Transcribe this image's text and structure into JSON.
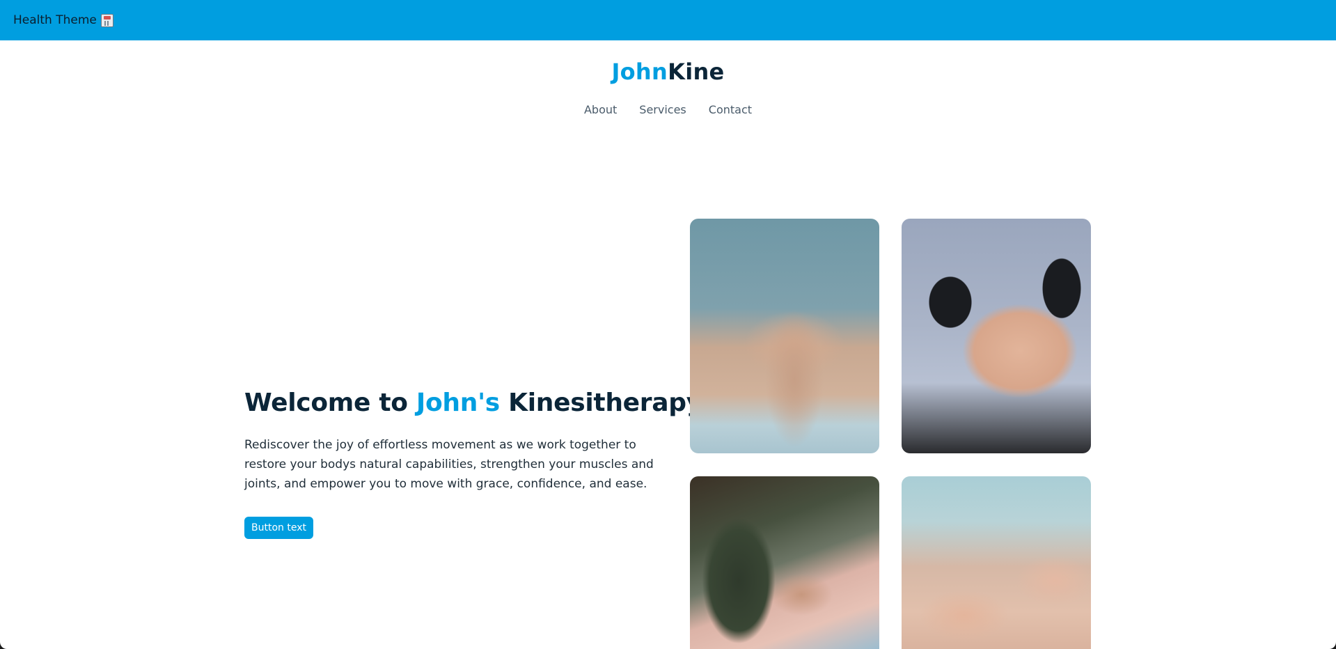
{
  "topbar": {
    "title": "Health Theme",
    "icon": "hospital-icon",
    "color": "#009ee0"
  },
  "logo": {
    "accent": "John",
    "rest": "Kine"
  },
  "nav": {
    "items": [
      "About",
      "Services",
      "Contact"
    ]
  },
  "hero": {
    "title_before": "Welcome to ",
    "title_accent": "John's",
    "title_after": " Kinesitherapy",
    "text": "Rediscover the joy of effortless movement as we work together to restore your bodys natural capabilities, strengthen your muscles and joints, and empower you to move with grace, confidence, and ease.",
    "button_label": "Button text"
  },
  "colors": {
    "accent": "#009ee0",
    "heading": "#0b2538"
  }
}
